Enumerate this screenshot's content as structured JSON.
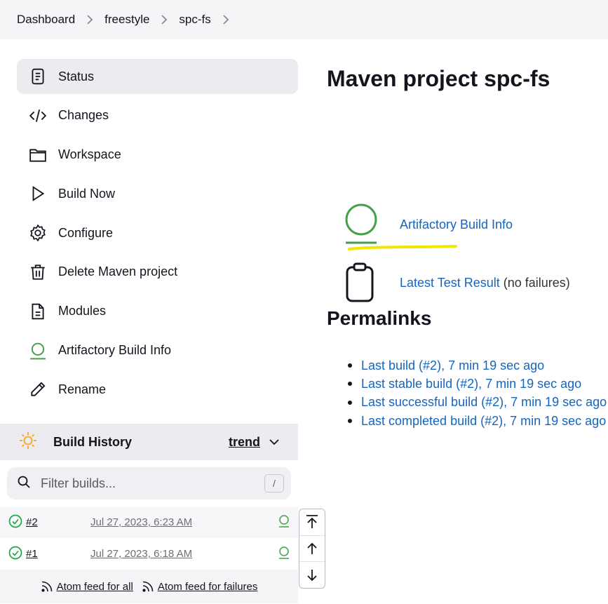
{
  "breadcrumb": [
    "Dashboard",
    "freestyle",
    "spc-fs"
  ],
  "sidebar": {
    "tasks": [
      {
        "label": "Status",
        "icon": "document-icon",
        "active": true
      },
      {
        "label": "Changes",
        "icon": "code-icon"
      },
      {
        "label": "Workspace",
        "icon": "folder-icon"
      },
      {
        "label": "Build Now",
        "icon": "play-icon"
      },
      {
        "label": "Configure",
        "icon": "gear-icon"
      },
      {
        "label": "Delete Maven project",
        "icon": "trash-icon"
      },
      {
        "label": "Modules",
        "icon": "file-text-icon"
      },
      {
        "label": "Artifactory Build Info",
        "icon": "artifactory-icon"
      },
      {
        "label": "Rename",
        "icon": "pencil-icon"
      }
    ]
  },
  "build_history": {
    "title": "Build History",
    "trend_label": "trend",
    "filter_placeholder": "Filter builds...",
    "filter_shortcut": "/",
    "builds": [
      {
        "number": "#2",
        "date": "Jul 27, 2023, 6:23 AM",
        "status": "success"
      },
      {
        "number": "#1",
        "date": "Jul 27, 2023, 6:18 AM",
        "status": "success"
      }
    ],
    "feed_all": "Atom feed for all",
    "feed_failures": "Atom feed for failures"
  },
  "main": {
    "title": "Maven project spc-fs",
    "artifactory_link": "Artifactory Build Info",
    "test_result_link": "Latest Test Result",
    "test_result_note": "(no failures)",
    "permalinks_title": "Permalinks",
    "permalinks": [
      "Last build (#2), 7 min 19 sec ago",
      "Last stable build (#2), 7 min 19 sec ago",
      "Last successful build (#2), 7 min 19 sec ago",
      "Last completed build (#2), 7 min 19 sec ago"
    ]
  },
  "colors": {
    "link": "#1565c0",
    "success": "#1ea64b",
    "artifactory": "#43a047",
    "highlight": "#f2e600",
    "sun": "#f5a623"
  }
}
